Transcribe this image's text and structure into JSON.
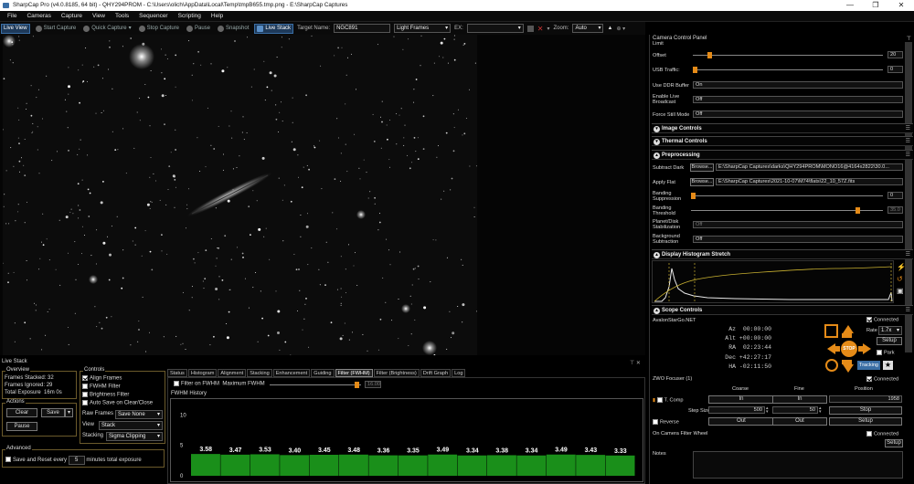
{
  "window": {
    "title": "SharpCap Pro (v4.0.8185, 64 bit) - QHY294PROM - C:\\Users\\olich\\AppData\\Local\\Temp\\tmpB655.tmp.png - E:\\SharpCap Captures",
    "controls": [
      "—",
      "❐",
      "✕"
    ]
  },
  "menu": [
    "File",
    "Cameras",
    "Capture",
    "View",
    "Tools",
    "Sequencer",
    "Scripting",
    "Help"
  ],
  "toolbar": {
    "live_view": "Live View",
    "start_capture": "Start Capture",
    "quick_capture": "Quick Capture",
    "stop_capture": "Stop Capture",
    "pause": "Pause",
    "snapshot": "Snapshot",
    "live_stack": "Live Stack",
    "target_label": "Target Name:",
    "target_value": "NGC891",
    "frame_type": "Light Frames",
    "ex_label": "EX:",
    "zoom_label": "Zoom:",
    "zoom_value": "Auto"
  },
  "livestack": {
    "title": "Live Stack",
    "overview": {
      "legend": "Overview",
      "frames_stacked_label": "Frames Stacked:",
      "frames_stacked": "32",
      "frames_ignored_label": "Frames Ignored:",
      "frames_ignored": "29",
      "total_exposure_label": "Total Exposure",
      "total_exposure": "16m 0s"
    },
    "actions": {
      "legend": "Actions",
      "clear": "Clear",
      "save": "Save",
      "pause": "Pause"
    },
    "advanced": {
      "legend": "Advanced",
      "save_reset_label": "Save and Reset every",
      "minutes": "5",
      "suffix": "minutes total exposure"
    },
    "controls": {
      "legend": "Controls",
      "align_frames": "Align Frames",
      "fwhm_filter": "FWHM Filter",
      "brightness_filter": "Brightness Filter",
      "auto_save": "Auto Save on Clear/Close",
      "raw_frames_label": "Raw Frames",
      "raw_frames_value": "Save None",
      "view_label": "View",
      "view_value": "Stack",
      "stacking_label": "Stacking",
      "stacking_value": "Sigma Clipping"
    },
    "tabs": [
      "Status",
      "Histogram",
      "Alignment",
      "Stacking",
      "Enhancement",
      "Guiding",
      "Filter (FWHM)",
      "Filter (Brightness)",
      "Drift Graph",
      "Log"
    ],
    "active_tab": 6,
    "filter": {
      "label": "Filter on FWHM",
      "max_label": "Maximum FWHM",
      "max_value": "16.00",
      "history_title": "FWHM History"
    }
  },
  "chart_data": {
    "type": "bar",
    "title": "FWHM History",
    "categories": [
      "",
      "",
      "",
      "",
      "",
      "",
      "",
      "",
      "",
      "",
      "",
      "",
      "",
      "",
      ""
    ],
    "values": [
      3.58,
      3.47,
      3.53,
      3.4,
      3.45,
      3.48,
      3.36,
      3.35,
      3.49,
      3.34,
      3.38,
      3.34,
      3.49,
      3.43,
      3.33
    ],
    "labels": [
      "3.58",
      "3.47",
      "3.53",
      "3.40",
      "3.45",
      "3.48",
      "3.36",
      "3.35",
      "3.49",
      "3.34",
      "3.38",
      "3.34",
      "3.49",
      "3.43",
      "3.33"
    ],
    "ylim": [
      0,
      12
    ],
    "yticks": [
      "10",
      "5",
      "0"
    ],
    "ytick_values": [
      10,
      5,
      0
    ],
    "bar_color": "#1a8f1a",
    "grid": false
  },
  "camera_panel": {
    "title": "Camera Control Panel",
    "limit": "Limit",
    "offset_label": "Offset",
    "offset_value": "20",
    "offset_fraction": 0.08,
    "usb_label": "USB Traffic:",
    "usb_value": "0",
    "usb_fraction": 0.0,
    "ddr_label": "Use DDR Buffer",
    "ddr_value": "On",
    "live_broadcast_label": "Enable Live Broadcast",
    "live_broadcast_value": "Off",
    "force_still_label": "Force Still Mode",
    "force_still_value": "Off",
    "sections": {
      "image_controls": "Image Controls",
      "thermal_controls": "Thermal Controls",
      "preprocessing": "Preprocessing",
      "histogram": "Display Histogram Stretch",
      "scope": "Scope Controls"
    },
    "pre": {
      "dark_label": "Subtract Dark",
      "browse": "Browse...",
      "dark_path": "E:\\SharpCap Captures\\darks\\QHY294PROM\\MONO16@4164x2822\\30.0...",
      "flat_label": "Apply Flat",
      "flat_path": "E:\\SharpCap Captures\\2021-10-07\\M74\\flats\\22_10_57Z.fits",
      "banding_supp_label": "Banding Suppression",
      "banding_supp_value": "0",
      "banding_supp_fraction": 0.0,
      "banding_thresh_label": "Banding Threshold",
      "banding_thresh_value": "35.0",
      "banding_thresh_fraction": 0.88,
      "pd_label": "Planet/Disk Stabilization",
      "pd_value": "Off",
      "bg_label": "Background Subtraction",
      "bg_value": "Off"
    },
    "scope": {
      "mount": "AvalonStarGo.NET",
      "connected": "Connected",
      "az_label": "Az",
      "az": "00:00:00",
      "alt_label": "Alt",
      "alt": "+00:00:00",
      "ra_label": "RA",
      "ra": "02:23:44",
      "dec_label": "Dec",
      "dec": "+42:27:17",
      "ha_label": "HA",
      "ha": "-02:11:50",
      "rate_label": "Rate",
      "rate_value": "1.7x",
      "setup": "Setup",
      "park": "Park",
      "stop": "STOP",
      "tracking": "Tracking"
    },
    "focuser": {
      "name": "ZWO Focuser (1)",
      "connected": "Connected",
      "coarse": "Coarse",
      "fine": "Fine",
      "position": "Position",
      "tcomp": "T. Comp",
      "in": "In",
      "out": "Out",
      "position_value": "1958",
      "step_size_label": "Step Size",
      "coarse_step": "500",
      "fine_step": "50",
      "stop": "Stop",
      "reverse": "Reverse",
      "setup": "Setup"
    },
    "filter_wheel": {
      "name": "On Camera Filter Wheel",
      "connected": "Connected",
      "setup": "Setup"
    },
    "notes_label": "Notes"
  },
  "colors": {
    "accent": "#e58b18",
    "highlight": "#3a6ea5",
    "bar": "#1a8f1a",
    "frame": "#6b5a2b"
  }
}
